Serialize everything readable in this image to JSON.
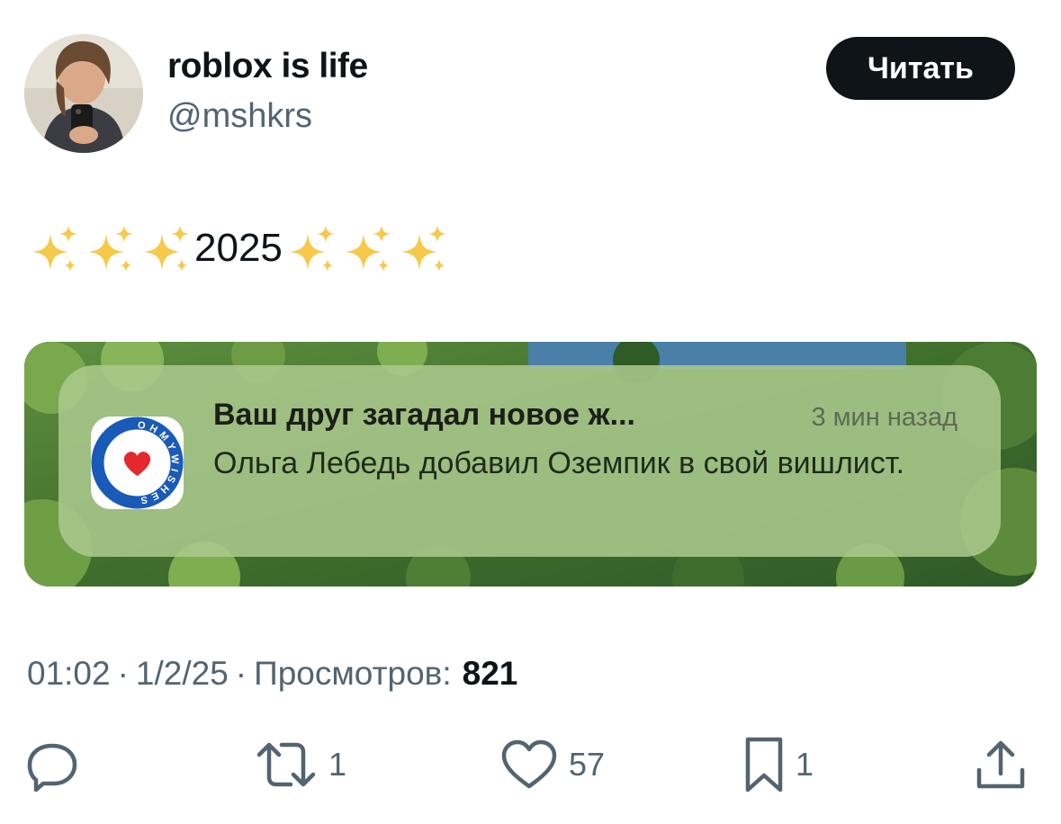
{
  "author": {
    "display_name": "roblox is life",
    "handle": "@mshkrs",
    "avatar_icon": "user-avatar-photo"
  },
  "follow_button": {
    "label": "Читать"
  },
  "tweet": {
    "text_core": "2025",
    "sparkle_icon": "sparkles-emoji"
  },
  "media": {
    "notification": {
      "app_icon": "wishlist-heart-app-icon",
      "app_icon_text": "OHMYWISHES",
      "title": "Ваш друг загадал новое ж...",
      "time": "3 мин назад",
      "body": "Ольга Лебедь добавил Оземпик в свой вишлист."
    }
  },
  "meta": {
    "time": "01:02",
    "date": "1/2/25",
    "views_label": "Просмотров:",
    "views_count": "821"
  },
  "actions": {
    "reply": {
      "icon": "reply-icon"
    },
    "retweet": {
      "icon": "retweet-icon",
      "count": "1"
    },
    "like": {
      "icon": "heart-icon",
      "count": "57"
    },
    "bookmark": {
      "icon": "bookmark-icon",
      "count": "1"
    },
    "share": {
      "icon": "share-icon"
    }
  },
  "colors": {
    "text": "#0f1419",
    "muted": "#536471",
    "sparkle": "#f6c94b",
    "heart": "#e3282e",
    "icon_ring": "#1a5ab8"
  }
}
